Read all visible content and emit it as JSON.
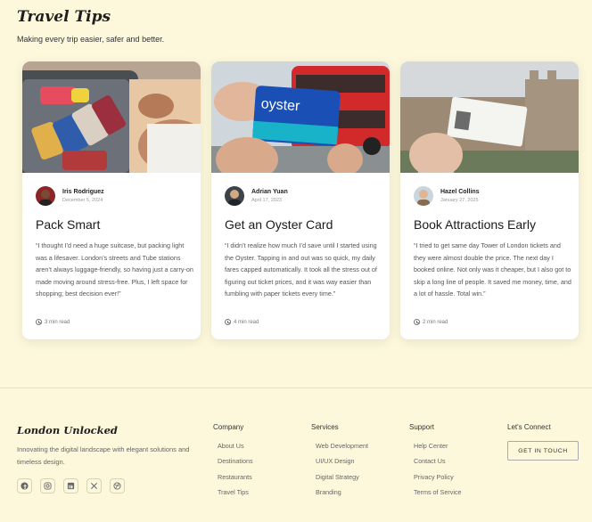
{
  "header": {
    "title": "Travel Tips",
    "subtitle": "Making every trip easier, safer and better."
  },
  "cards": [
    {
      "author": "Iris Rodriguez",
      "date": "December 5, 2024",
      "title": "Pack Smart",
      "text": "“I thought I’d need a huge suitcase, but packing light was a lifesaver. London’s streets and Tube stations aren’t always luggage-friendly, so having just a carry-on made moving around stress-free. Plus, I left space for shopping; best decision ever!”",
      "read_time": "3 min read"
    },
    {
      "author": "Adrian Yuan",
      "date": "April 17, 2023",
      "title": "Get an Oyster Card",
      "text": "“I didn’t realize how much I’d save until I started using the Oyster. Tapping in and out was so quick, my daily fares capped automatically. It took all the stress out of figuring out ticket prices, and it was way easier than fumbling with paper tickets every time.”",
      "read_time": "4 min read"
    },
    {
      "author": "Hazel Collins",
      "date": "January 27, 2025",
      "title": "Book Attractions Early",
      "text": "“I tried to get same day Tower of London tickets and they were almost double the price. The next day I booked online. Not only was it cheaper, but I also got to skip a long line of people. It saved me money, time, and a lot of hassle. Total win.”",
      "read_time": "2 min read"
    }
  ],
  "footer": {
    "brand": "London Unlocked",
    "description": "Innovating the digital landscape with elegant solutions and timeless design.",
    "socials": [
      "facebook-icon",
      "instagram-icon",
      "linkedin-icon",
      "x-icon",
      "dribbble-icon"
    ],
    "columns": [
      {
        "title": "Company",
        "links": [
          "About Us",
          "Destinations",
          "Restaurants",
          "Travel Tips"
        ]
      },
      {
        "title": "Services",
        "links": [
          "Web Development",
          "UI/UX Design",
          "Digital Strategy",
          "Branding"
        ]
      },
      {
        "title": "Support",
        "links": [
          "Help Center",
          "Contact Us",
          "Privacy Policy",
          "Terms of Service"
        ]
      }
    ],
    "connect_title": "Let's Connect",
    "cta_label": "GET IN TOUCH"
  }
}
